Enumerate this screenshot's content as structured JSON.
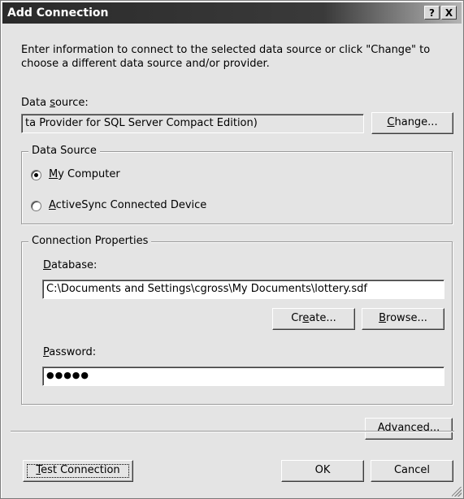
{
  "window": {
    "title": "Add Connection",
    "help_glyph": "?",
    "close_glyph": "X"
  },
  "intro": "Enter information to connect to the selected data source or click \"Change\" to choose a different data source and/or provider.",
  "data_source": {
    "label_pre": "Data ",
    "label_key": "s",
    "label_post": "ource:",
    "value": "ta Provider for SQL Server Compact Edition)",
    "change_button_key": "C",
    "change_button_rest": "hange..."
  },
  "data_source_group": {
    "legend": "Data Source",
    "options": [
      {
        "key": "M",
        "rest": "y Computer",
        "selected": true
      },
      {
        "key": "A",
        "rest": "ctiveSync Connected Device",
        "selected": false
      }
    ]
  },
  "connection_properties": {
    "legend": "Connection Properties",
    "database_label_key": "D",
    "database_label_rest": "atabase:",
    "database_value": "C:\\Documents and Settings\\cgross\\My Documents\\lottery.sdf",
    "create_button_pre": "Cr",
    "create_button_key": "e",
    "create_button_post": "ate...",
    "browse_button_key": "B",
    "browse_button_rest": "rowse...",
    "password_label_key": "P",
    "password_label_rest": "assword:",
    "password_value": "●●●●●"
  },
  "advanced_button": {
    "pre": "Ad",
    "key": "v",
    "post": "anced..."
  },
  "footer": {
    "test_key": "T",
    "test_rest": "est Connection",
    "ok_label": "OK",
    "cancel_label": "Cancel"
  }
}
